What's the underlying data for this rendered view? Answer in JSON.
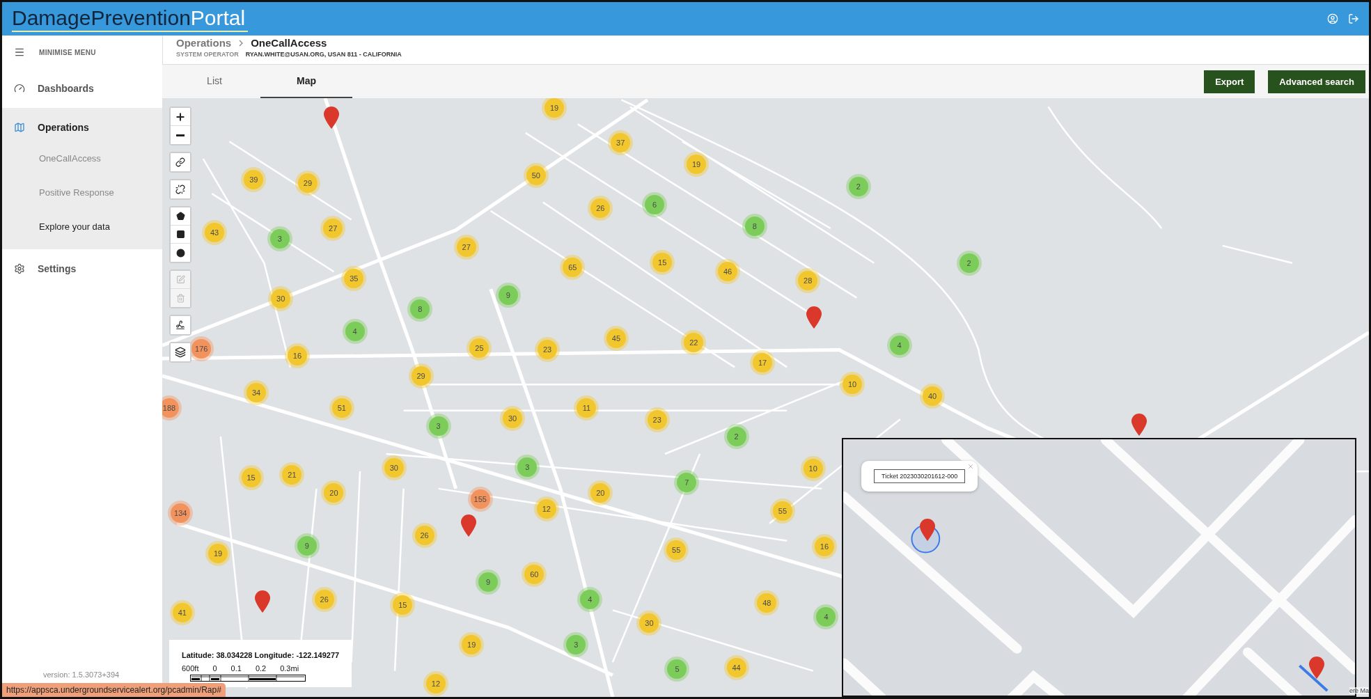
{
  "header": {
    "logo_parts": [
      "DamagePrevention",
      "Portal"
    ]
  },
  "sidebar": {
    "minimise_label": "MINIMISE MENU",
    "items": [
      {
        "label": "Dashboards",
        "selected": false,
        "expanded": false
      },
      {
        "label": "Operations",
        "selected": true,
        "expanded": true,
        "children": [
          {
            "label": "OneCallAccess",
            "selected": false
          },
          {
            "label": "Positive Response",
            "selected": false
          },
          {
            "label": "Explore your data",
            "selected": true
          }
        ]
      },
      {
        "label": "Settings",
        "selected": false,
        "expanded": false
      }
    ],
    "version": "version: 1.5.3073+394"
  },
  "breadcrumb": {
    "parent": "Operations",
    "current": "OneCallAccess"
  },
  "operator": {
    "label": "SYSTEM OPERATOR",
    "value": "RYAN.WHITE@USAN.ORG, USAN 811 - CALIFORNIA"
  },
  "tabs": [
    {
      "label": "List",
      "selected": false
    },
    {
      "label": "Map",
      "selected": true
    }
  ],
  "buttons": [
    "Export",
    "Advanced search"
  ],
  "draw_tools": [
    {
      "kind": "polygon",
      "disabled": false
    },
    {
      "kind": "rectangle",
      "disabled": false
    },
    {
      "kind": "circle",
      "disabled": false
    },
    {
      "kind": "edit",
      "disabled": true
    },
    {
      "kind": "delete",
      "disabled": true
    }
  ],
  "clusters": [
    {
      "count": "19",
      "color": "#f2c72e"
    },
    {
      "count": "37",
      "color": "#f2c72e"
    },
    {
      "count": "19",
      "color": "#f2c72e"
    },
    {
      "count": "39",
      "color": "#f2c72e"
    },
    {
      "count": "29",
      "color": "#f2c72e"
    },
    {
      "count": "50",
      "color": "#f2c72e"
    },
    {
      "count": "2",
      "color": "#7ccc5a"
    },
    {
      "count": "26",
      "color": "#f2c72e"
    },
    {
      "count": "6",
      "color": "#7ccc5a"
    },
    {
      "count": "8",
      "color": "#7ccc5a"
    },
    {
      "count": "43",
      "color": "#f2c72e"
    },
    {
      "count": "3",
      "color": "#7ccc5a"
    },
    {
      "count": "27",
      "color": "#f2c72e"
    },
    {
      "count": "27",
      "color": "#f2c72e"
    },
    {
      "count": "65",
      "color": "#f2c72e"
    },
    {
      "count": "15",
      "color": "#f2c72e"
    },
    {
      "count": "46",
      "color": "#f2c72e"
    },
    {
      "count": "28",
      "color": "#f2c72e"
    },
    {
      "count": "2",
      "color": "#7ccc5a"
    },
    {
      "count": "35",
      "color": "#f2c72e"
    },
    {
      "count": "9",
      "color": "#7ccc5a"
    },
    {
      "count": "30",
      "color": "#f2c72e"
    },
    {
      "count": "8",
      "color": "#7ccc5a"
    },
    {
      "count": "4",
      "color": "#7ccc5a"
    },
    {
      "count": "45",
      "color": "#f2c72e"
    },
    {
      "count": "22",
      "color": "#f2c72e"
    },
    {
      "count": "25",
      "color": "#f2c72e"
    },
    {
      "count": "23",
      "color": "#f2c72e"
    },
    {
      "count": "16",
      "color": "#f2c72e"
    },
    {
      "count": "17",
      "color": "#f2c72e"
    },
    {
      "count": "176",
      "color": "#f2935e"
    },
    {
      "count": "4",
      "color": "#7ccc5a"
    },
    {
      "count": "29",
      "color": "#f2c72e"
    },
    {
      "count": "10",
      "color": "#f2c72e"
    },
    {
      "count": "40",
      "color": "#f2c72e"
    },
    {
      "count": "34",
      "color": "#f2c72e"
    },
    {
      "count": "188",
      "color": "#f2935e"
    },
    {
      "count": "51",
      "color": "#f2c72e"
    },
    {
      "count": "30",
      "color": "#f2c72e"
    },
    {
      "count": "11",
      "color": "#f2c72e"
    },
    {
      "count": "23",
      "color": "#f2c72e"
    },
    {
      "count": "3",
      "color": "#7ccc5a"
    },
    {
      "count": "2",
      "color": "#7ccc5a"
    },
    {
      "count": "30",
      "color": "#f2c72e"
    },
    {
      "count": "3",
      "color": "#7ccc5a"
    },
    {
      "count": "15",
      "color": "#f2c72e"
    },
    {
      "count": "21",
      "color": "#f2c72e"
    },
    {
      "count": "10",
      "color": "#f2c72e"
    },
    {
      "count": "20",
      "color": "#f2c72e"
    },
    {
      "count": "155",
      "color": "#f2935e"
    },
    {
      "count": "20",
      "color": "#f2c72e"
    },
    {
      "count": "7",
      "color": "#7ccc5a"
    },
    {
      "count": "12",
      "color": "#f2c72e"
    },
    {
      "count": "134",
      "color": "#f2935e"
    },
    {
      "count": "55",
      "color": "#f2c72e"
    },
    {
      "count": "26",
      "color": "#f2c72e"
    },
    {
      "count": "9",
      "color": "#7ccc5a"
    },
    {
      "count": "55",
      "color": "#f2c72e"
    },
    {
      "count": "16",
      "color": "#f2c72e"
    },
    {
      "count": "19",
      "color": "#f2c72e"
    },
    {
      "count": "60",
      "color": "#f2c72e"
    },
    {
      "count": "9",
      "color": "#7ccc5a"
    },
    {
      "count": "4",
      "color": "#7ccc5a"
    },
    {
      "count": "15",
      "color": "#f2c72e"
    },
    {
      "count": "26",
      "color": "#f2c72e"
    },
    {
      "count": "41",
      "color": "#f2c72e"
    },
    {
      "count": "30",
      "color": "#f2c72e"
    },
    {
      "count": "48",
      "color": "#f2c72e"
    },
    {
      "count": "4",
      "color": "#7ccc5a"
    },
    {
      "count": "19",
      "color": "#f2c72e"
    },
    {
      "count": "3",
      "color": "#7ccc5a"
    },
    {
      "count": "5",
      "color": "#7ccc5a"
    },
    {
      "count": "44",
      "color": "#f2c72e"
    },
    {
      "count": "12",
      "color": "#f2c72e"
    }
  ],
  "coordinates": {
    "text": "Latitude: 38.034228 Longitude: -122.149277",
    "scale_labels": [
      "600ft",
      "0",
      "0.1",
      "0.2",
      "0.3mi"
    ]
  },
  "inset_map": {
    "popup": "Ticket 2023030201612-000",
    "attribution": "ere Ma"
  },
  "status_url": "https://appsca.undergroundservicealert.org/pcadmin/Rap#"
}
